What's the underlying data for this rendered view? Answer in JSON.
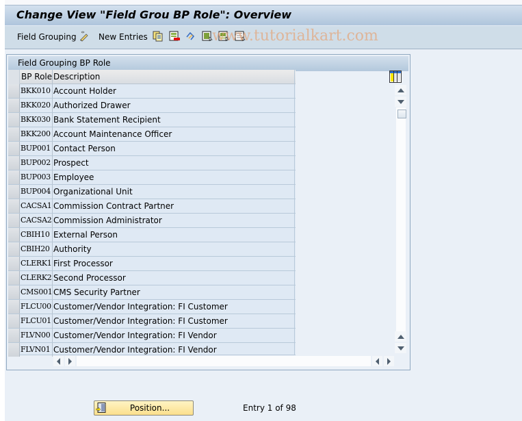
{
  "window": {
    "title": "Change View \"Field Grou BP Role\": Overview"
  },
  "toolbar": {
    "field_grouping_label": "Field Grouping",
    "new_entries_label": "New Entries",
    "icons": [
      "display-change-icon",
      "copy-icon",
      "delete-icon",
      "undo-change-icon",
      "select-all-icon",
      "select-block-icon",
      "deselect-all-icon"
    ]
  },
  "watermark": "www.tutorialkart.com",
  "panel": {
    "title": "Field Grouping BP Role",
    "columns": [
      "BP Role",
      "Description"
    ],
    "rows": [
      {
        "code": "BKK010",
        "description": "Account Holder"
      },
      {
        "code": "BKK020",
        "description": "Authorized Drawer"
      },
      {
        "code": "BKK030",
        "description": "Bank Statement Recipient"
      },
      {
        "code": "BKK200",
        "description": "Account Maintenance Officer"
      },
      {
        "code": "BUP001",
        "description": "Contact Person"
      },
      {
        "code": "BUP002",
        "description": "Prospect"
      },
      {
        "code": "BUP003",
        "description": "Employee"
      },
      {
        "code": "BUP004",
        "description": "Organizational Unit"
      },
      {
        "code": "CACSA1",
        "description": "Commission Contract Partner"
      },
      {
        "code": "CACSA2",
        "description": "Commission Administrator"
      },
      {
        "code": "CBIH10",
        "description": "External Person"
      },
      {
        "code": "CBIH20",
        "description": "Authority"
      },
      {
        "code": "CLERK1",
        "description": "First Processor"
      },
      {
        "code": "CLERK2",
        "description": "Second Processor"
      },
      {
        "code": "CMS001",
        "description": "CMS Security Partner"
      },
      {
        "code": "FLCU00",
        "description": "Customer/Vendor Integration: FI Customer"
      },
      {
        "code": "FLCU01",
        "description": "Customer/Vendor Integration: FI Customer"
      },
      {
        "code": "FLVN00",
        "description": "Customer/Vendor Integration: FI Vendor"
      },
      {
        "code": "FLVN01",
        "description": "Customer/Vendor Integration: FI Vendor"
      }
    ]
  },
  "footer": {
    "position_button_label": "Position...",
    "entry_text": "Entry 1 of 98"
  },
  "colors": {
    "title_gradient_top": "#d3e0ee",
    "title_gradient_bottom": "#afc5dc",
    "toolbar_bg": "#cfdde8",
    "row_bg": "#dfe9f4",
    "position_button": "#fbe08c"
  }
}
